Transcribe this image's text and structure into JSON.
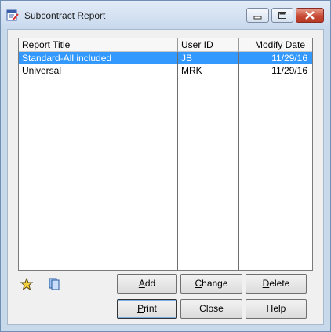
{
  "window": {
    "title": "Subcontract Report"
  },
  "list": {
    "columns": {
      "title": "Report Title",
      "user": "User ID",
      "date": "Modify Date"
    },
    "rows": [
      {
        "title": "Standard-All included",
        "user": "JB",
        "date": "11/29/16",
        "selected": true
      },
      {
        "title": "Universal",
        "user": "MRK",
        "date": "11/29/16",
        "selected": false
      }
    ]
  },
  "buttons": {
    "add": {
      "accel": "A",
      "rest": "dd"
    },
    "change": {
      "accel": "C",
      "rest": "hange"
    },
    "delete": {
      "accel": "D",
      "rest": "elete"
    },
    "print": {
      "accel": "P",
      "rest": "rint"
    },
    "close": "Close",
    "help": "Help"
  },
  "colors": {
    "selection": "#3399ff",
    "titlebar": "#c8d9ee",
    "close_button": "#c84b36"
  },
  "icons": [
    "app-report-icon",
    "minimize-icon",
    "maximize-icon",
    "close-icon",
    "star-icon",
    "copy-icon"
  ]
}
